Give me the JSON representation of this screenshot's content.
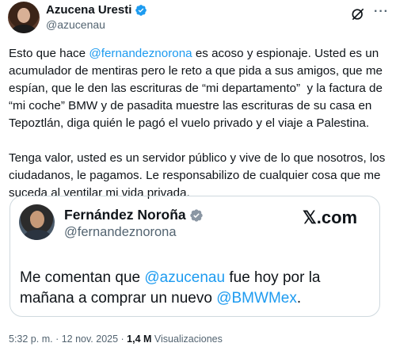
{
  "author": {
    "name": "Azucena Uresti",
    "handle": "@azucenau"
  },
  "icons": {
    "verified": "verified-badge-icon",
    "grok": "grok-icon",
    "more": "more-options-icon"
  },
  "colors": {
    "accent": "#1d9bf0",
    "secondary_text": "#536471",
    "border": "#cfd9de"
  },
  "post": {
    "p1_a": "Esto que hace ",
    "p1_mention": "@fernandeznorona",
    "p1_b": " es acoso y espionaje. Usted es un acumulador de mentiras pero le reto a que pida a sus amigos, que me espían, que le den las escrituras de “mi departamento”  y la factura de “mi coche” BMW y de pasadita muestre las escrituras de su casa en Tepoztlán, diga quién le pagó el vuelo privado y el viaje a Palestina.",
    "p2": "Tenga valor, usted es un servidor público y vive de lo que nosotros, los ciudadanos, le pagamos. Le responsabilizo de cualquier cosa que me suceda al ventilar mi vida privada."
  },
  "quoted": {
    "name": "Fernández Noroña",
    "handle": "@fernandeznorona",
    "brand": "𝕏.com",
    "text_a": "Me comentan que ",
    "mention1": "@azucenau",
    "text_b": " fue hoy por la mañana a comprar un nuevo ",
    "mention2": "@BMWMex",
    "text_c": "."
  },
  "footer": {
    "time": "5:32 p. m.",
    "sep1": " · ",
    "date": "12 nov. 2025",
    "sep2": " · ",
    "views": "1,4 M",
    "views_label": " Visualizaciones"
  }
}
